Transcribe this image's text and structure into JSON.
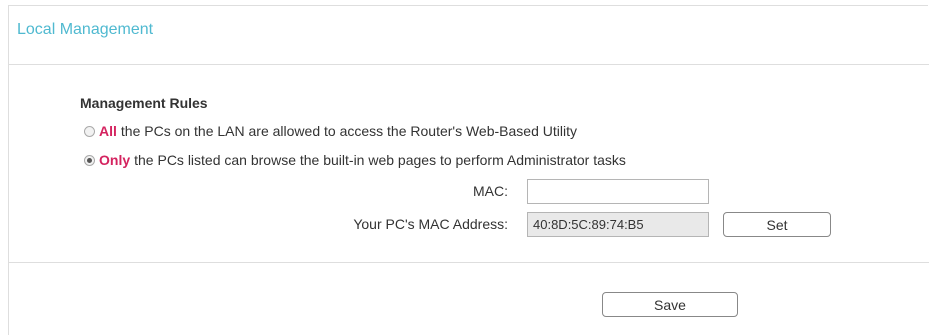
{
  "panel": {
    "title": "Local Management"
  },
  "management_rules": {
    "label": "Management Rules",
    "options": [
      {
        "keyword": "All",
        "text": "the PCs on the LAN are allowed to access the Router's Web-Based Utility",
        "checked": false
      },
      {
        "keyword": "Only",
        "text": "the PCs listed can browse the built-in web pages to perform Administrator tasks",
        "checked": true
      }
    ]
  },
  "mac_field": {
    "label": "MAC:",
    "value": ""
  },
  "pc_mac_field": {
    "label": "Your PC's MAC Address:",
    "value": "40:8D:5C:89:74:B5"
  },
  "buttons": {
    "set_label": "Set",
    "save_label": "Save"
  },
  "colors": {
    "title": "#4fb9d0",
    "keyword": "#d4235f",
    "border": "#dedede",
    "readonly_bg": "#e9e9e9"
  }
}
